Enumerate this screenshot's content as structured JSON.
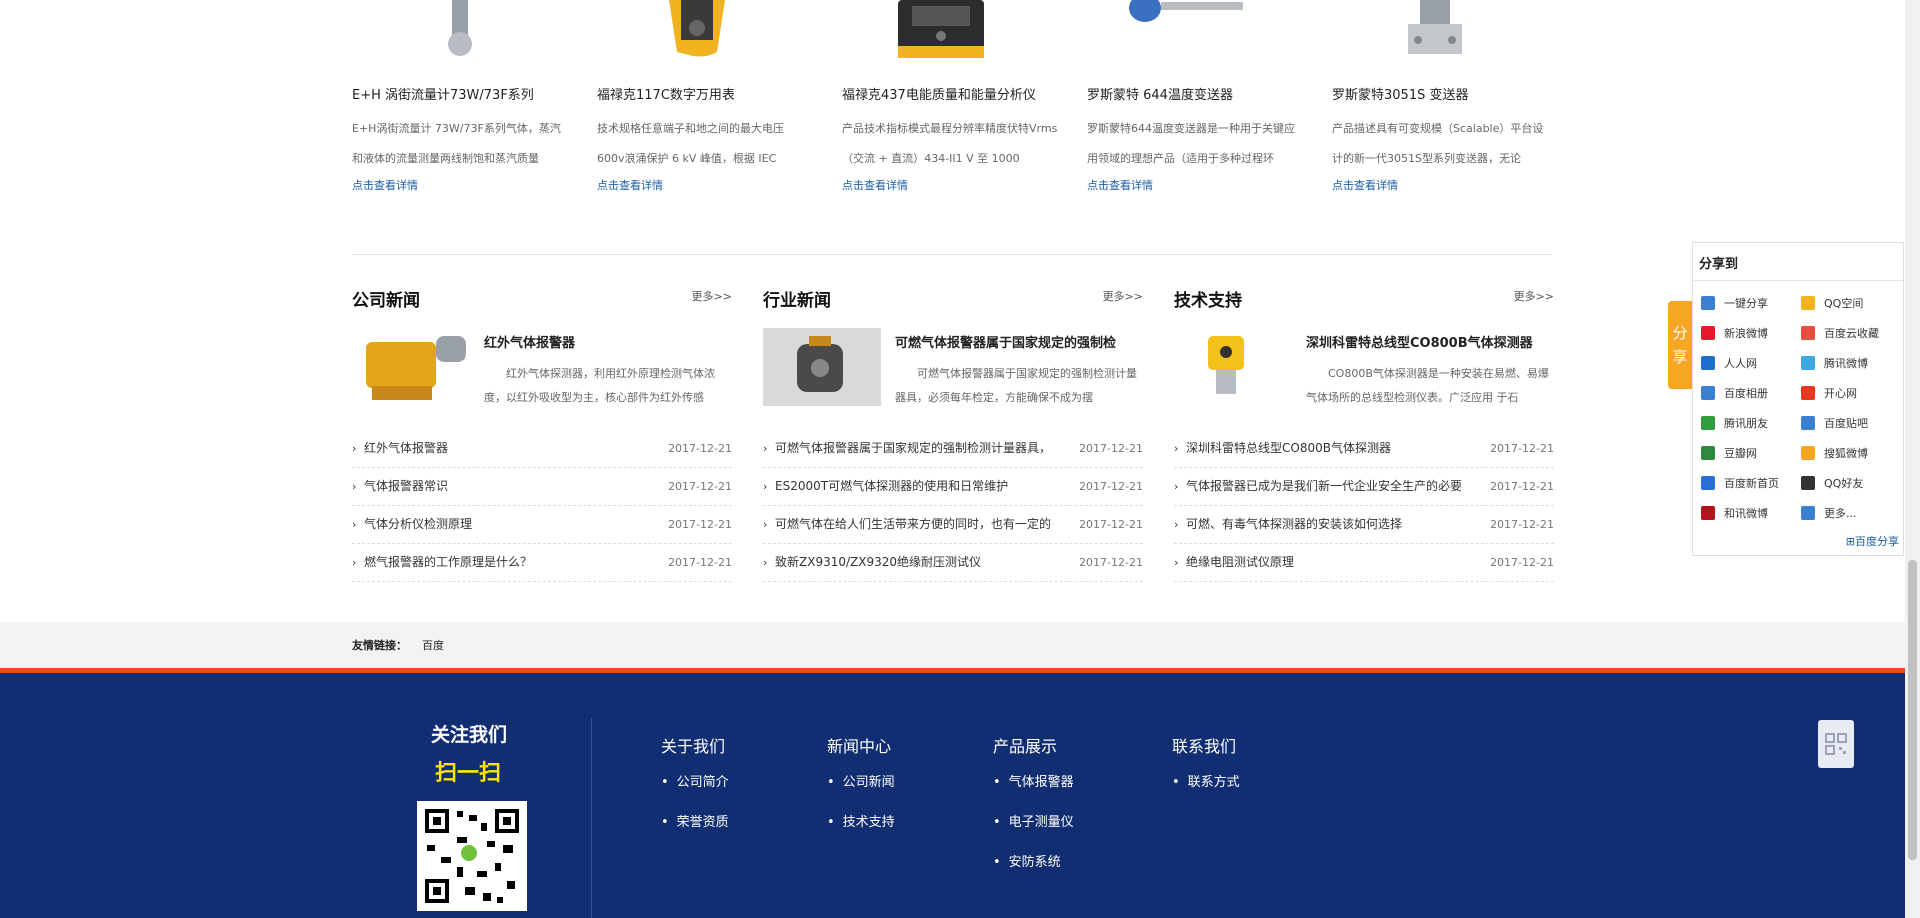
{
  "products": [
    {
      "title": "E+H 涡街流量计73W/73F系列",
      "desc": "E+H涡街流量计  73W/73F系列气体，蒸汽和液体的流量测量两线制饱和蒸汽质量",
      "more": "点击查看详情"
    },
    {
      "title": "福禄克117C数字万用表",
      "desc": "技术规格任意端子和地之间的最大电压 600v浪涌保护 6 kV 峰值，根据 IEC",
      "more": "点击查看详情"
    },
    {
      "title": "福禄克437电能质量和能量分析仪",
      "desc": "产品技术指标模式最程分辨率精度伏特Vrms（交流 + 直流）434-II1 V 至 1000",
      "more": "点击查看详情"
    },
    {
      "title": "罗斯蒙特 644温度变送器",
      "desc": "罗斯蒙特644温度变送器是一种用于关键应用领域的理想产品（适用于多种过程环",
      "more": "点击查看详情"
    },
    {
      "title": "罗斯蒙特3051S 变送器",
      "desc": "产品描述具有可变规模（Scalable）平台设计的新一代3051S型系列变送器，无论",
      "more": "点击查看详情"
    }
  ],
  "news": [
    {
      "heading": "公司新闻",
      "more": "更多>>",
      "ft_title": "红外气体报警器",
      "ft_desc": "红外气体探测器，利用红外原理检测气体浓度，以红外吸收型为主，核心部件为红外传感",
      "items": [
        {
          "t": "红外气体报警器",
          "d": "2017-12-21"
        },
        {
          "t": "气体报警器常识",
          "d": "2017-12-21"
        },
        {
          "t": "气体分析仪检测原理",
          "d": "2017-12-21"
        },
        {
          "t": "燃气报警器的工作原理是什么？",
          "d": "2017-12-21"
        }
      ]
    },
    {
      "heading": "行业新闻",
      "more": "更多>>",
      "ft_title": "可燃气体报警器属于国家规定的强制检",
      "ft_desc": "可燃气体报警器属于国家规定的强制检测计量器具，必须每年检定，方能确保不成为摆",
      "items": [
        {
          "t": "可燃气体报警器属于国家规定的强制检测计量器具，",
          "d": "2017-12-21"
        },
        {
          "t": "ES2000T可燃气体探测器的使用和日常维护",
          "d": "2017-12-21"
        },
        {
          "t": "可燃气体在给人们生活带来方便的同时，也有一定的",
          "d": "2017-12-21"
        },
        {
          "t": "致新ZX9310/ZX9320绝缘耐压测试仪",
          "d": "2017-12-21"
        }
      ]
    },
    {
      "heading": "技术支持",
      "more": "更多>>",
      "ft_title": "深圳科雷特总线型CO800B气体探测器",
      "ft_desc": "CO800B气体探测器是一种安装在易燃、易爆气体场所的总线型检测仪表。广泛应用    于石",
      "items": [
        {
          "t": "深圳科雷特总线型CO800B气体探测器",
          "d": "2017-12-21"
        },
        {
          "t": "气体报警器已成为是我们新一代企业安全生产的必要",
          "d": "2017-12-21"
        },
        {
          "t": "可燃、有毒气体探测器的安装该如何选择",
          "d": "2017-12-21"
        },
        {
          "t": "绝缘电阻测试仪原理",
          "d": "2017-12-21"
        }
      ]
    }
  ],
  "friend": {
    "label": "友情链接：",
    "link": "百度"
  },
  "footer": {
    "follow": "关注我们",
    "scan": "扫一扫",
    "cols": [
      {
        "h": "关于我们",
        "items": [
          "公司简介",
          "荣誉资质"
        ]
      },
      {
        "h": "新闻中心",
        "items": [
          "公司新闻",
          "技术支持"
        ]
      },
      {
        "h": "产品展示",
        "items": [
          "气体报警器",
          "电子测量仪",
          "安防系统"
        ]
      },
      {
        "h": "联系我们",
        "items": [
          "联系方式"
        ]
      }
    ]
  },
  "share": {
    "tab": "分享",
    "heading": "分享到",
    "footer": "百度分享",
    "items": [
      {
        "label": "一键分享",
        "color": "#3b7fd1"
      },
      {
        "label": "QQ空间",
        "color": "#f2b321"
      },
      {
        "label": "新浪微博",
        "color": "#e6162d"
      },
      {
        "label": "百度云收藏",
        "color": "#e84d3c"
      },
      {
        "label": "人人网",
        "color": "#1d6fc9"
      },
      {
        "label": "腾讯微博",
        "color": "#3da8e0"
      },
      {
        "label": "百度相册",
        "color": "#3b7fd1"
      },
      {
        "label": "开心网",
        "color": "#e8361f"
      },
      {
        "label": "腾讯朋友",
        "color": "#2e9e3c"
      },
      {
        "label": "百度贴吧",
        "color": "#3b7fd1"
      },
      {
        "label": "豆瓣网",
        "color": "#2d8a3c"
      },
      {
        "label": "搜狐微博",
        "color": "#f6a623"
      },
      {
        "label": "百度新首页",
        "color": "#2b6fd6"
      },
      {
        "label": "QQ好友",
        "color": "#333333"
      },
      {
        "label": "和讯微博",
        "color": "#b3141c"
      },
      {
        "label": "更多...",
        "color": "#3b7fd1"
      }
    ]
  }
}
